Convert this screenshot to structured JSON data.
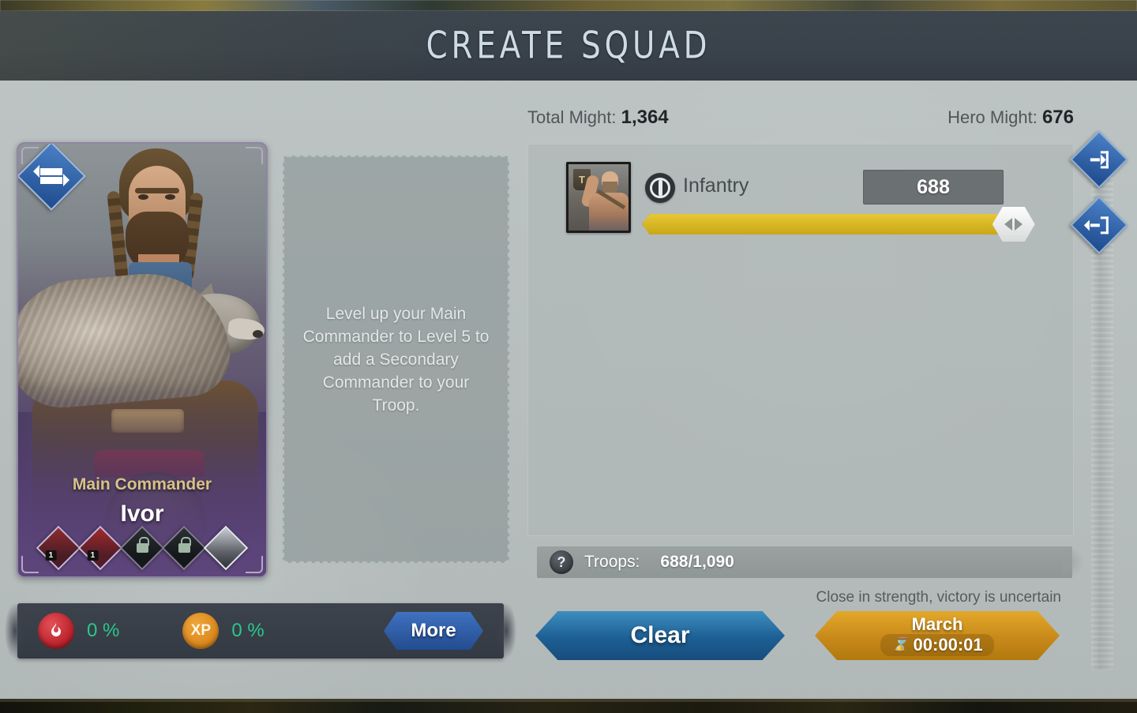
{
  "header": {
    "title": "CREATE SQUAD"
  },
  "commander": {
    "role_label": "Main Commander",
    "name": "Ivor",
    "swap_icon": "swap-arrows-icon",
    "skills": [
      {
        "name": "skill-slot-1",
        "state": "unlocked",
        "level": "1"
      },
      {
        "name": "skill-slot-2",
        "state": "unlocked",
        "level": "1"
      },
      {
        "name": "skill-slot-3",
        "state": "locked",
        "level": ""
      },
      {
        "name": "skill-slot-4",
        "state": "locked",
        "level": ""
      },
      {
        "name": "skill-slot-5",
        "state": "unlocked",
        "level": ""
      }
    ]
  },
  "secondary_slot": {
    "message": "Level up your Main Commander to Level 5 to add a Secondary Commander to your Troop."
  },
  "stats_bar": {
    "bonus_icon": "flame-icon",
    "bonus_value": "0 %",
    "xp_icon_label": "XP",
    "xp_value": "0 %",
    "more_label": "More"
  },
  "might": {
    "total_label": "Total Might:",
    "total_value": "1,364",
    "hero_label": "Hero Might:",
    "hero_value": "676"
  },
  "troops": {
    "rows": [
      {
        "icon": "infantry-emblem-icon",
        "name": "Infantry",
        "count": "688",
        "slider_percent": 97
      }
    ],
    "summary": {
      "help_icon": "question-mark-icon",
      "label": "Troops:",
      "value": "688/1,090"
    },
    "warning": "Close in strength, victory is uncertain"
  },
  "actions": {
    "clear_label": "Clear",
    "march_label": "March",
    "march_timer": "00:00:01",
    "timer_icon": "hourglass-icon"
  },
  "side_buttons": [
    {
      "name": "add-all-troops-button",
      "icon": "arrow-into-bracket-icon"
    },
    {
      "name": "remove-all-troops-button",
      "icon": "arrow-out-of-bracket-icon"
    }
  ],
  "colors": {
    "accent_blue": "#2d6aa8",
    "accent_gold": "#d3b52a",
    "panel_gray": "#b9c0c0",
    "header_slate": "#3a424b",
    "green_value": "#27c98a",
    "gold_text": "#d9c187"
  }
}
